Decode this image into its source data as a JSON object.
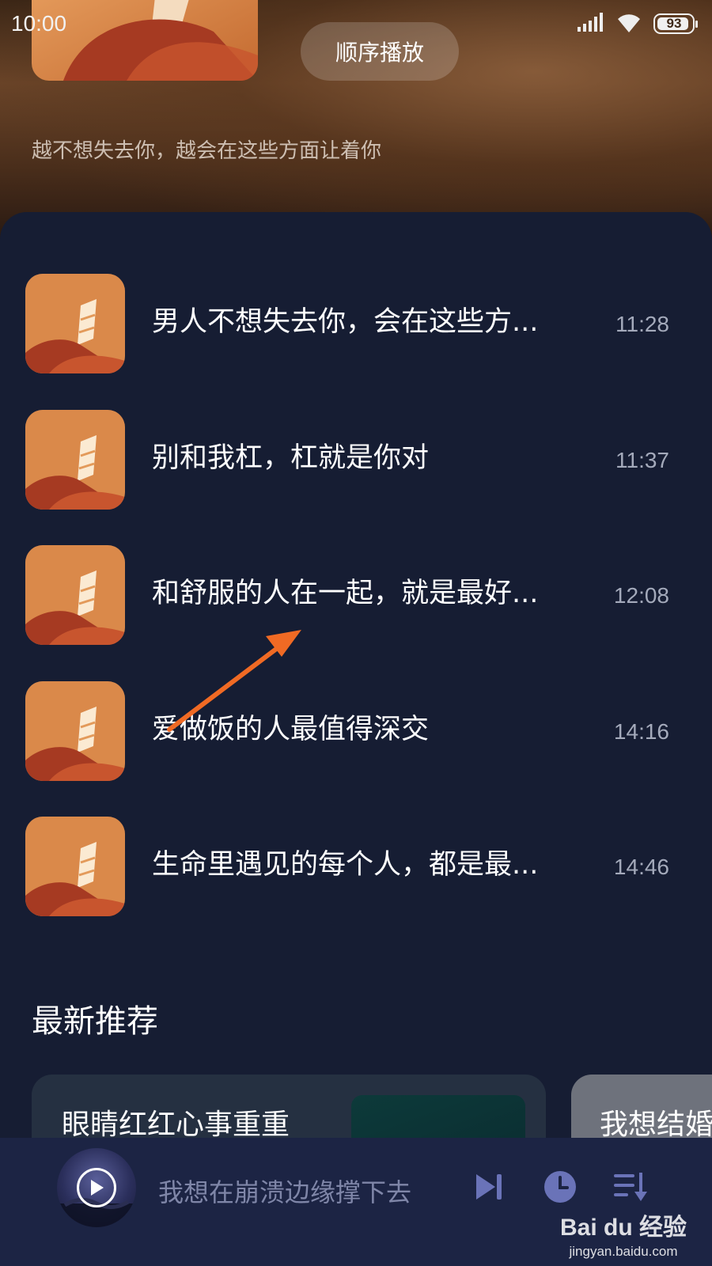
{
  "status_bar": {
    "time": "10:00",
    "battery": "93",
    "battery_level": 0.93,
    "icons": [
      "signal-icon",
      "wifi-icon",
      "battery-icon"
    ]
  },
  "header": {
    "play_mode": "顺序播放",
    "album_description": "越不想失去你，越会在这些方面让着你"
  },
  "episodes": [
    {
      "title": "男人不想失去你，会在这些方...",
      "duration": "11:28"
    },
    {
      "title": "别和我杠，杠就是你对",
      "duration": "11:37"
    },
    {
      "title": "和舒服的人在一起，就是最好...",
      "duration": "12:08"
    },
    {
      "title": "爱做饭的人最值得深交",
      "duration": "14:16"
    },
    {
      "title": "生命里遇见的每个人，都是最...",
      "duration": "14:46"
    }
  ],
  "recommend": {
    "title": "最新推荐",
    "cards": [
      {
        "title": "眼睛红红心事重重"
      },
      {
        "title": "我想结婚"
      }
    ]
  },
  "mini_player": {
    "track_title": "我想在崩溃边缘撑下去",
    "controls": [
      "play-icon",
      "next-track-icon",
      "timer-icon",
      "playlist-icon"
    ]
  },
  "watermark": {
    "logo": "Bai du 经验",
    "url": "jingyan.baidu.com"
  },
  "colors": {
    "panel_bg": "#161d33",
    "player_bg": "#1c2444",
    "arrow": "#f06a24",
    "duration_text": "#a4aabb"
  }
}
